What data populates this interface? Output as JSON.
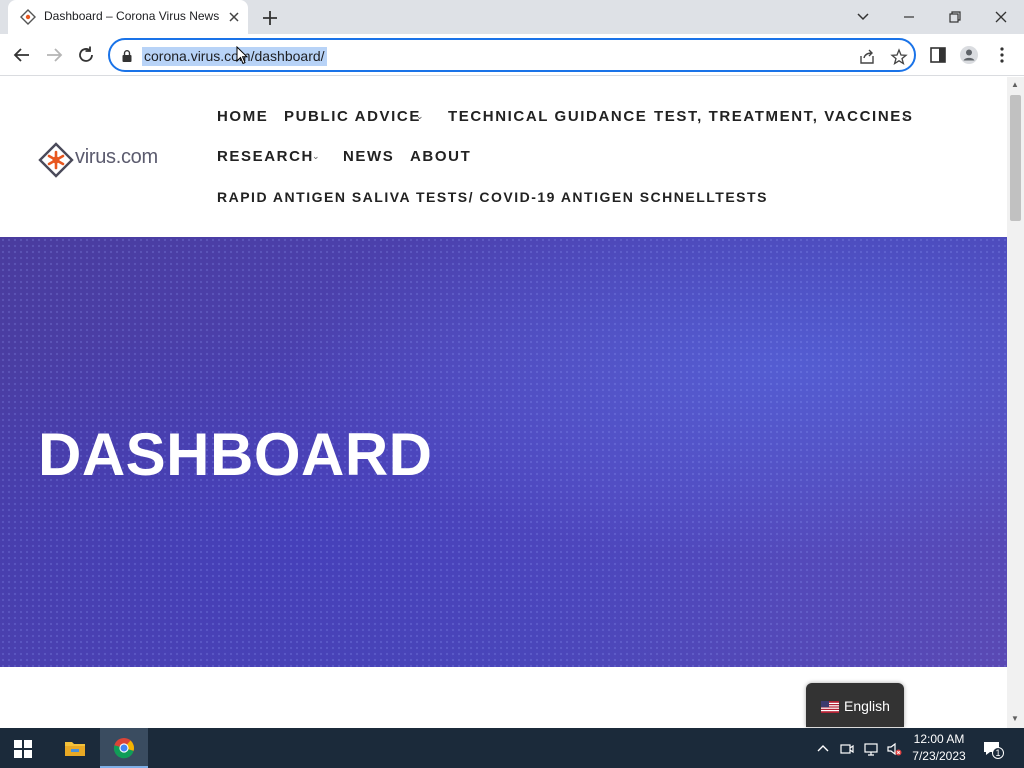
{
  "browser": {
    "tab_title": "Dashboard – Corona Virus News",
    "url": "corona.virus.com/dashboard/"
  },
  "site": {
    "logo_text": "virus.com",
    "nav": {
      "home": "HOME",
      "public_advice": "PUBLIC ADVICE",
      "technical_guidance": "TECHNICAL GUIDANCE",
      "test_treatment_vaccines": "TEST, TREATMENT, VACCINES",
      "research": "RESEARCH",
      "news": "NEWS",
      "about": "ABOUT",
      "rapid_antigen": "RAPID ANTIGEN SALIVA TESTS/ COVID-19 ANTIGEN SCHNELLTESTS"
    },
    "hero_title": "DASHBOARD",
    "language": "English"
  },
  "taskbar": {
    "time": "12:00 AM",
    "date": "7/23/2023",
    "notification_count": "1"
  },
  "colors": {
    "accent": "#1a73e8",
    "logo_orange": "#e8571f",
    "hero": "#4c42b2",
    "taskbar": "#1b2a3a"
  }
}
